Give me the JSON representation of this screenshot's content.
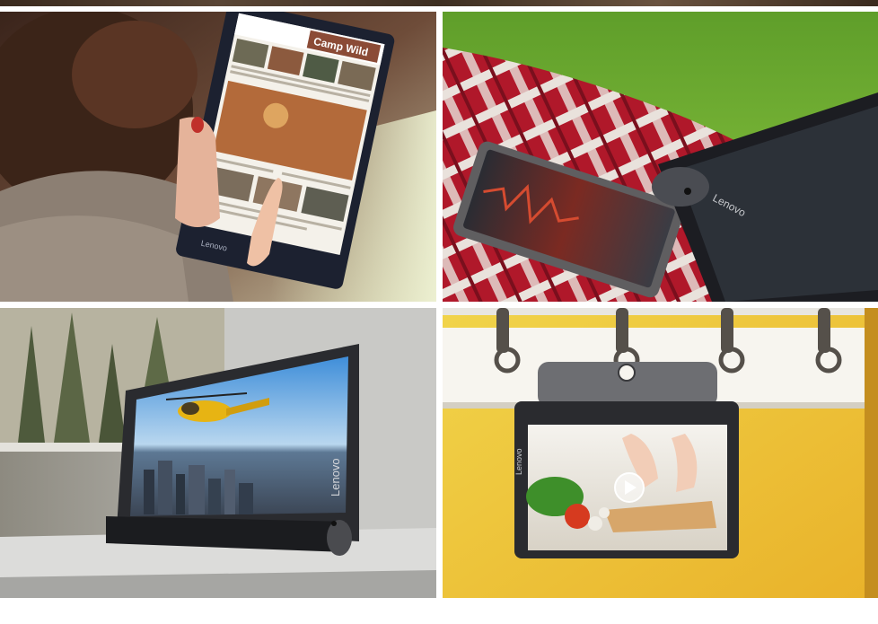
{
  "photos": [
    {
      "screen_heading": "Camp Wild",
      "device_brand": "Lenovo"
    },
    {
      "device_brand": "Lenovo"
    },
    {
      "device_brand": "Lenovo"
    },
    {
      "device_brand": "Lenovo"
    }
  ]
}
